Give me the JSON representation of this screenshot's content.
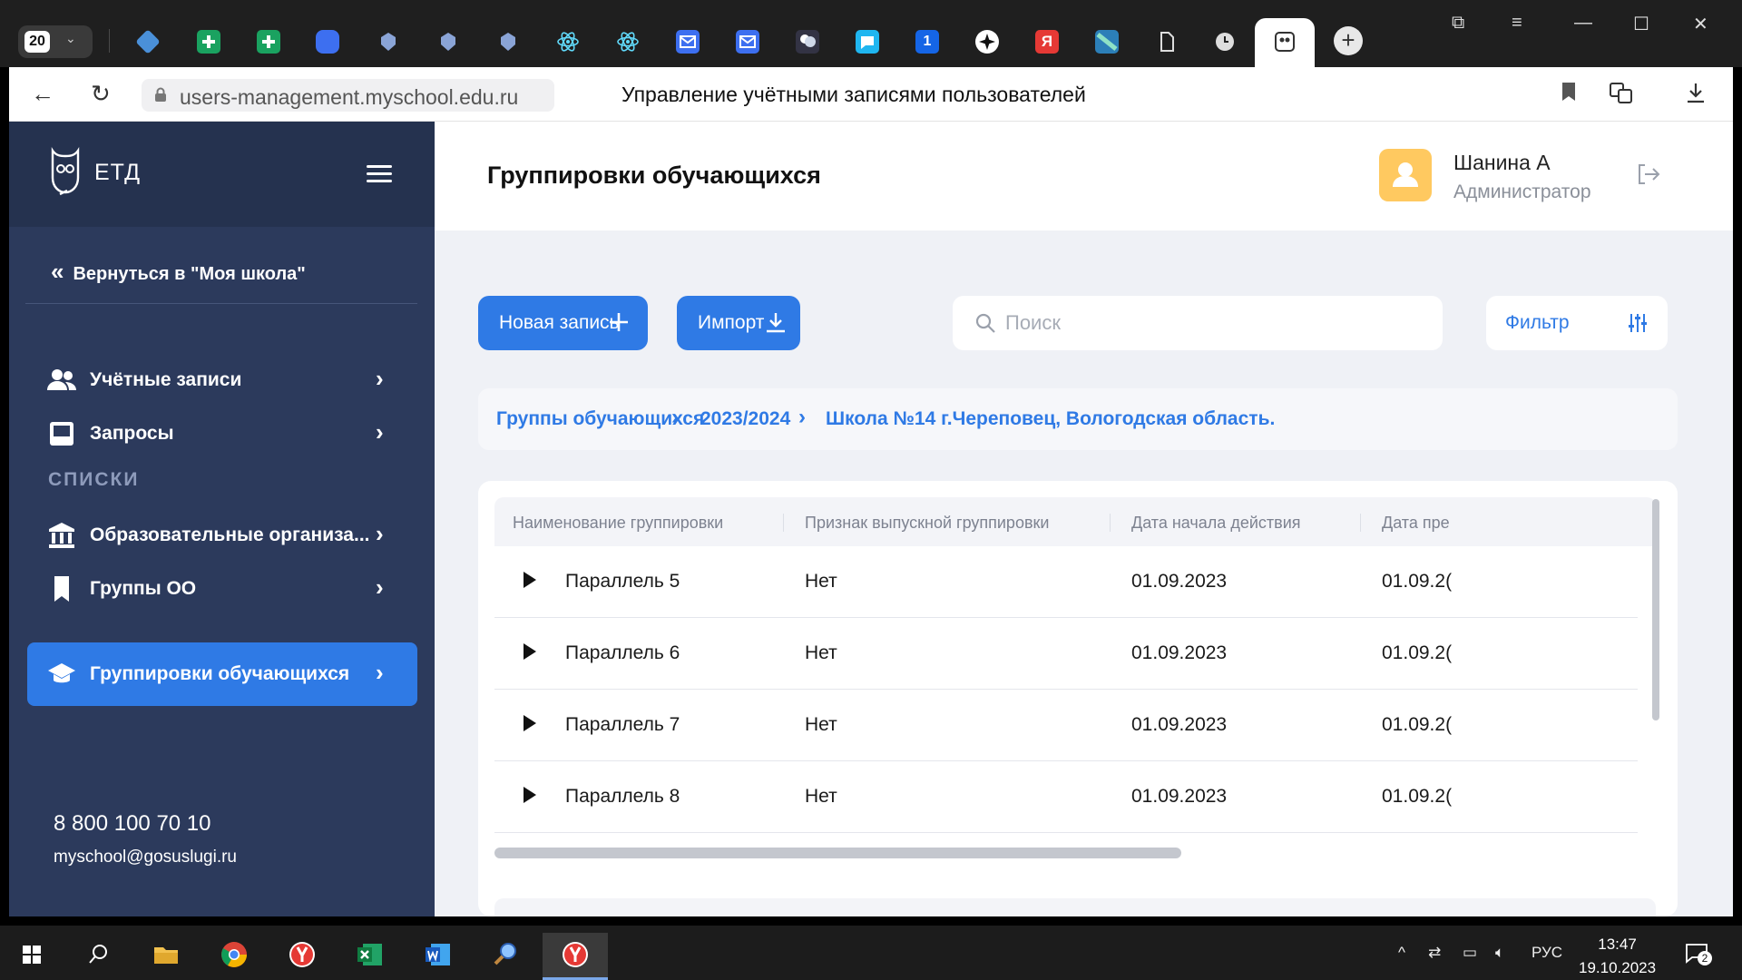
{
  "browser": {
    "tab_count": "20",
    "url": "users-management.myschool.edu.ru",
    "page_title": "Управление учётными записями пользователей",
    "accent": "#2f7ae5"
  },
  "sidebar": {
    "logo_text": "ЕТД",
    "back_label": "Вернуться в \"Моя школа\"",
    "items": [
      {
        "label": "Учётные записи",
        "icon": "users-icon"
      },
      {
        "label": "Запросы",
        "icon": "inbox-icon"
      }
    ],
    "section_title": "СПИСКИ",
    "list_items": [
      {
        "label": "Образовательные организа...",
        "icon": "institution-icon"
      },
      {
        "label": "Группы ОО",
        "icon": "bookmark-icon"
      },
      {
        "label": "Группировки обучающихся",
        "icon": "graduation-cap-icon",
        "active": true
      }
    ],
    "phone": "8 800 100 70 10",
    "email": "myschool@gosuslugi.ru"
  },
  "header": {
    "title": "Группировки обучающихся",
    "user_name": "Шанина А",
    "user_role": "Администратор"
  },
  "toolbar": {
    "new_label": "Новая запись",
    "import_label": "Импорт",
    "search_placeholder": "Поиск",
    "filter_label": "Фильтр"
  },
  "breadcrumbs": [
    "Группы обучающихся",
    "2023/2024",
    "Школа №14 г.Череповец, Вологодская область."
  ],
  "table": {
    "columns": [
      "Наименование группировки",
      "Признак выпускной группировки",
      "Дата начала действия",
      "Дата пре"
    ],
    "rows": [
      {
        "name": "Параллель 5",
        "graduate": "Нет",
        "start": "01.09.2023",
        "end": "01.09.2("
      },
      {
        "name": "Параллель 6",
        "graduate": "Нет",
        "start": "01.09.2023",
        "end": "01.09.2("
      },
      {
        "name": "Параллель 7",
        "graduate": "Нет",
        "start": "01.09.2023",
        "end": "01.09.2("
      },
      {
        "name": "Параллель 8",
        "graduate": "Нет",
        "start": "01.09.2023",
        "end": "01.09.2("
      }
    ]
  },
  "taskbar": {
    "lang": "РУС",
    "time": "13:47",
    "date": "19.10.2023",
    "notifications": "2"
  }
}
